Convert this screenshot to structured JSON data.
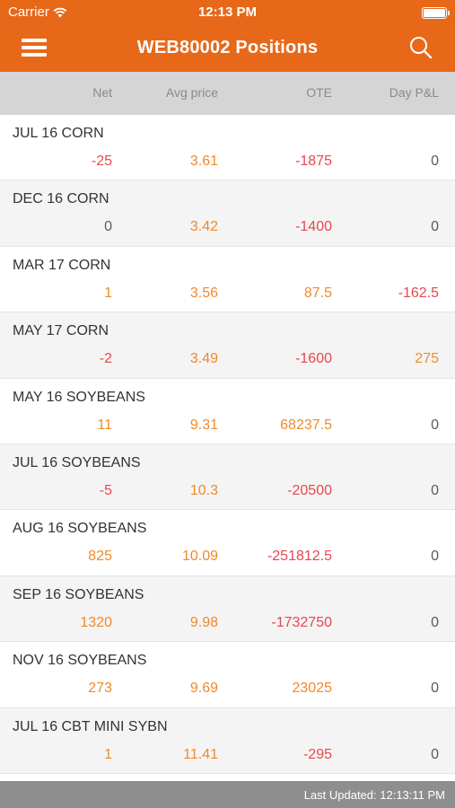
{
  "status_bar": {
    "carrier": "Carrier",
    "time": "12:13 PM"
  },
  "nav": {
    "title": "WEB80002 Positions"
  },
  "columns": {
    "net": "Net",
    "avg_price": "Avg price",
    "ote": "OTE",
    "day_pnl": "Day P&L"
  },
  "colors": {
    "accent": "#e8681a",
    "negative": "#e8474f",
    "positive": "#ef8a2a",
    "neutral": "#5a5a5a",
    "header_bg": "#d5d5d5",
    "footer_bg": "#8e8e8e"
  },
  "positions": [
    {
      "name": "JUL 16 CORN",
      "net": "-25",
      "avg": "3.61",
      "ote": "-1875",
      "pnl": "0"
    },
    {
      "name": "DEC 16 CORN",
      "net": "0",
      "avg": "3.42",
      "ote": "-1400",
      "pnl": "0"
    },
    {
      "name": "MAR 17 CORN",
      "net": "1",
      "avg": "3.56",
      "ote": "87.5",
      "pnl": "-162.5"
    },
    {
      "name": "MAY 17 CORN",
      "net": "-2",
      "avg": "3.49",
      "ote": "-1600",
      "pnl": "275"
    },
    {
      "name": "MAY 16 SOYBEANS",
      "net": "11",
      "avg": "9.31",
      "ote": "68237.5",
      "pnl": "0"
    },
    {
      "name": "JUL 16 SOYBEANS",
      "net": "-5",
      "avg": "10.3",
      "ote": "-20500",
      "pnl": "0"
    },
    {
      "name": "AUG 16 SOYBEANS",
      "net": "825",
      "avg": "10.09",
      "ote": "-251812.5",
      "pnl": "0"
    },
    {
      "name": "SEP 16 SOYBEANS",
      "net": "1320",
      "avg": "9.98",
      "ote": "-1732750",
      "pnl": "0"
    },
    {
      "name": "NOV 16 SOYBEANS",
      "net": "273",
      "avg": "9.69",
      "ote": "23025",
      "pnl": "0"
    },
    {
      "name": "JUL 16 CBT MINI SYBN",
      "net": "1",
      "avg": "11.41",
      "ote": "-295",
      "pnl": "0"
    }
  ],
  "footer": {
    "last_updated": "Last Updated: 12:13:11 PM"
  }
}
